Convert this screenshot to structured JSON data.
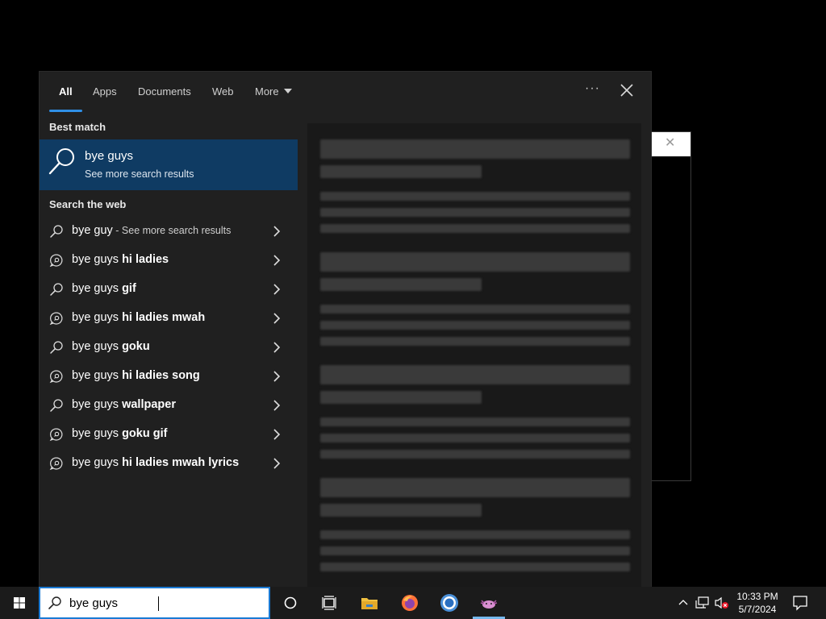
{
  "tabs": [
    {
      "label": "All",
      "active": true
    },
    {
      "label": "Apps"
    },
    {
      "label": "Documents"
    },
    {
      "label": "Web"
    },
    {
      "label": "More"
    }
  ],
  "header": {
    "more_options_label": "···"
  },
  "best_match": {
    "heading": "Best match",
    "title": "bye guys",
    "subtitle": "See more search results"
  },
  "search_web": {
    "heading": "Search the web",
    "items": [
      {
        "prefix": "bye guy",
        "bold": "",
        "hint": " - See more search results",
        "icon": "search-icon"
      },
      {
        "prefix": "bye guys",
        "bold": " hi ladies",
        "hint": "",
        "icon": "chat-search-icon"
      },
      {
        "prefix": "bye guys",
        "bold": " gif",
        "hint": "",
        "icon": "search-icon"
      },
      {
        "prefix": "bye guys",
        "bold": " hi ladies mwah",
        "hint": "",
        "icon": "chat-search-icon"
      },
      {
        "prefix": "bye guys",
        "bold": " goku",
        "hint": "",
        "icon": "search-icon"
      },
      {
        "prefix": "bye guys",
        "bold": " hi ladies song",
        "hint": "",
        "icon": "chat-search-icon"
      },
      {
        "prefix": "bye guys",
        "bold": " wallpaper",
        "hint": "",
        "icon": "search-icon"
      },
      {
        "prefix": "bye guys",
        "bold": " goku gif",
        "hint": "",
        "icon": "chat-search-icon"
      },
      {
        "prefix": "bye guys",
        "bold": " hi ladies mwah lyrics",
        "hint": "",
        "icon": "chat-search-icon"
      }
    ]
  },
  "taskbar": {
    "search_value": "bye guys",
    "apps": [
      "cortana-icon",
      "task-view-icon",
      "file-explorer-icon",
      "firefox-icon",
      "chrome-icon",
      "axolotl-app-icon"
    ],
    "time": "10:33 PM",
    "date": "5/7/2024"
  },
  "colors": {
    "accent": "#2f8fe6",
    "best_match_bg": "#0f3b63",
    "panel_bg": "#202020"
  }
}
